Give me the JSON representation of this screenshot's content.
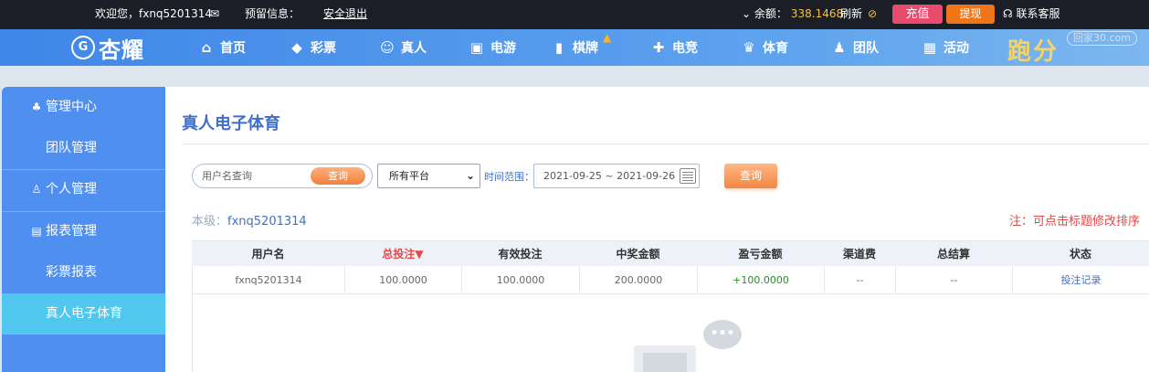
{
  "topbar": {
    "welcome": "欢迎您，fxnq5201314",
    "message_label": "预留信息：",
    "logout": "安全退出",
    "balance_label": "余额：",
    "balance_value": "338.1468",
    "refresh": "刷新",
    "deposit": "充值",
    "withdraw": "提现",
    "service": "联系客服"
  },
  "logo": {
    "name": "杏耀"
  },
  "nav": {
    "items": [
      {
        "label": "首页",
        "icon": "home-icon"
      },
      {
        "label": "彩票",
        "icon": "ticket-icon"
      },
      {
        "label": "真人",
        "icon": "person-icon"
      },
      {
        "label": "电游",
        "icon": "arcade-icon"
      },
      {
        "label": "棋牌",
        "icon": "cards-icon"
      },
      {
        "label": "电竞",
        "icon": "gamepad-icon"
      },
      {
        "label": "体育",
        "icon": "trophy-icon"
      },
      {
        "label": "团队",
        "icon": "team-icon"
      },
      {
        "label": "活动",
        "icon": "gift-icon"
      }
    ],
    "promo": "跑分",
    "watermark": "回家30.com"
  },
  "sidebar": {
    "items": [
      {
        "label": "管理中心",
        "type": "head"
      },
      {
        "label": "团队管理",
        "type": "sub"
      },
      {
        "label": "个人管理",
        "type": "head"
      },
      {
        "label": "报表管理",
        "type": "head"
      },
      {
        "label": "彩票报表",
        "type": "sub"
      },
      {
        "label": "真人电子体育",
        "type": "sub",
        "active": true
      }
    ]
  },
  "main": {
    "title": "真人电子体育",
    "search_placeholder": "用户名查询",
    "search_button": "查询",
    "platform_selected": "所有平台",
    "range_label": "时间范围：",
    "date_range": "2021-09-25 ~ 2021-09-26",
    "query_button": "查询",
    "level_label": "本级：",
    "level_user": "fxnq5201314",
    "note": "注：可点击标题修改排序"
  },
  "table": {
    "headers": [
      "用户名",
      "总投注▼",
      "有效投注",
      "中奖金额",
      "盈亏金额",
      "渠道费",
      "总结算",
      "状态"
    ],
    "rows": [
      [
        "fxnq5201314",
        "100.0000",
        "100.0000",
        "200.0000",
        "+100.0000",
        "--",
        "--",
        "投注记录"
      ]
    ]
  },
  "colors": {
    "topbar_bg": "#1b1e26",
    "nav_blue": "#3f86e8",
    "sidebar_blue": "#4f8ff0",
    "sidebar_active": "#4fc7ee",
    "accent_orange": "#f07f3f",
    "deposit_pink": "#e84b6b",
    "title_blue": "#3f6fc7",
    "note_red": "#e04a4a"
  }
}
